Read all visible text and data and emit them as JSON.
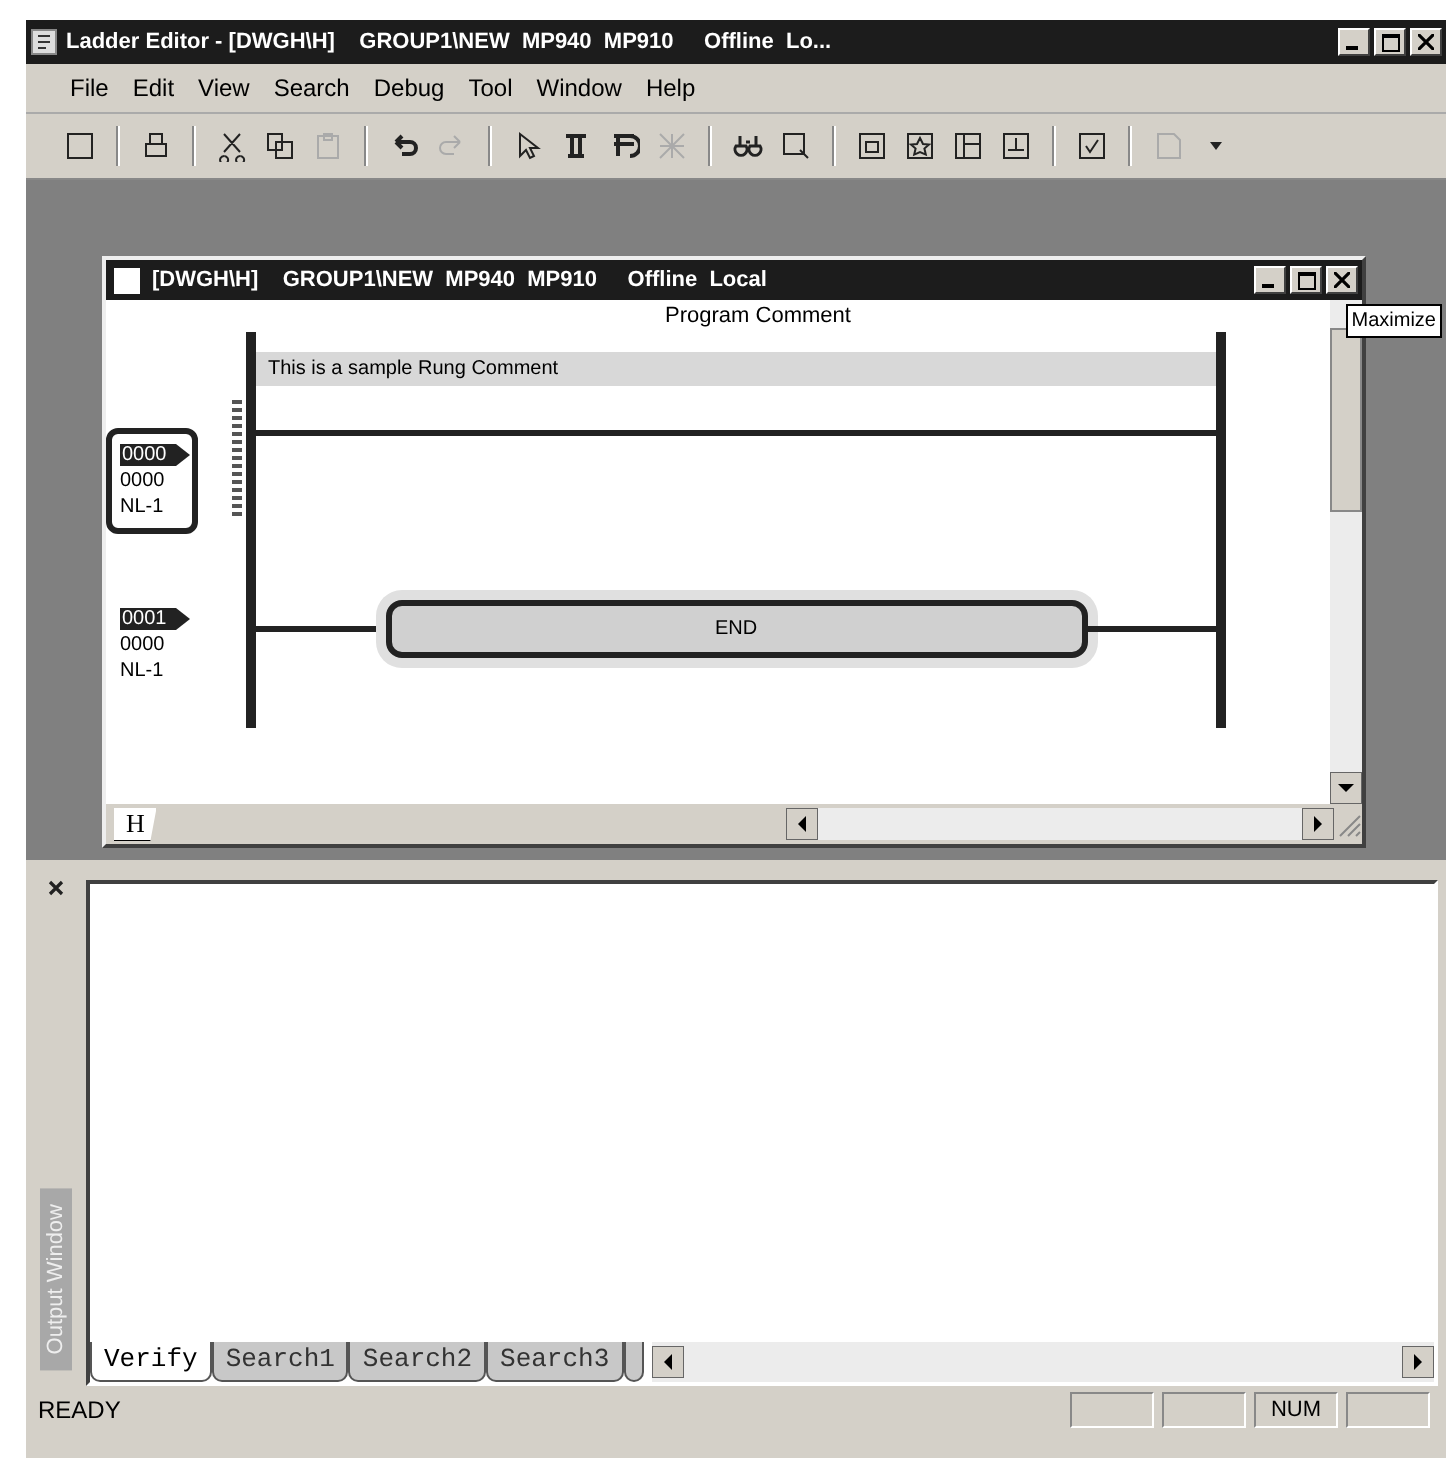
{
  "window": {
    "title": "Ladder Editor - [DWGH\\H]    GROUP1\\NEW  MP940  MP910     Offline  Lo..."
  },
  "menu": [
    {
      "label": "File"
    },
    {
      "label": "Edit"
    },
    {
      "label": "View"
    },
    {
      "label": "Search"
    },
    {
      "label": "Debug"
    },
    {
      "label": "Tool"
    },
    {
      "label": "Window"
    },
    {
      "label": "Help"
    }
  ],
  "toolbar": [
    {
      "disabled": false
    },
    {
      "disabled": false
    },
    {
      "disabled": false
    },
    {
      "disabled": false
    },
    {
      "disabled": true
    },
    {
      "disabled": false
    },
    {
      "disabled": true
    },
    {
      "disabled": false
    },
    {
      "disabled": false
    },
    {
      "disabled": false
    },
    {
      "disabled": true
    },
    {
      "disabled": false
    },
    {
      "disabled": false
    },
    {
      "disabled": false
    },
    {
      "disabled": false
    },
    {
      "disabled": false
    },
    {
      "disabled": false
    },
    {
      "disabled": false
    },
    {
      "disabled": true
    }
  ],
  "child_window": {
    "title": "[DWGH\\H]    GROUP1\\NEW  MP940  MP910     Offline  Local",
    "tooltip": "Maximize",
    "program_comment": "Program Comment",
    "sheet_tab": "H",
    "rungs": [
      {
        "number": "0000",
        "step": "0000",
        "label": "NL-1",
        "selected": true,
        "comment": "This is a sample Rung Comment",
        "kind": "empty"
      },
      {
        "number": "0001",
        "step": "0000",
        "label": "NL-1",
        "selected": false,
        "kind": "instruction",
        "instruction": "END"
      }
    ]
  },
  "output_window": {
    "title": "Output Window",
    "tabs": [
      {
        "label": "Verify",
        "selected": true
      },
      {
        "label": "Search1",
        "selected": false
      },
      {
        "label": "Search2",
        "selected": false
      },
      {
        "label": "Search3",
        "selected": false
      }
    ]
  },
  "status_bar": {
    "text": "READY",
    "num_indicator": "NUM"
  }
}
